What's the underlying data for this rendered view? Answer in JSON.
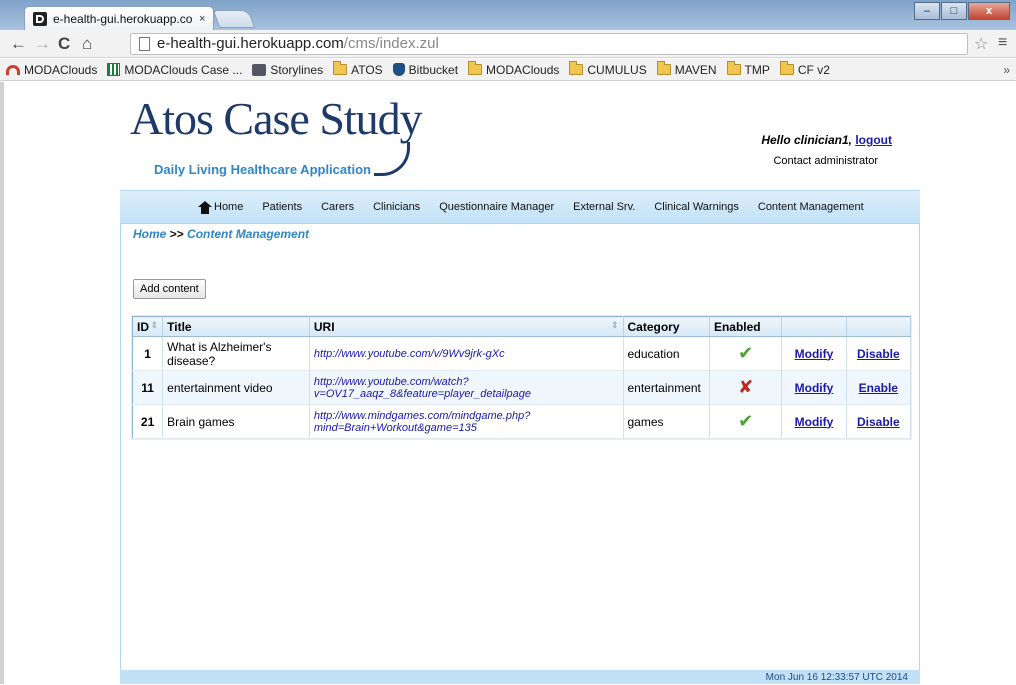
{
  "browser": {
    "tab_title": "e-health-gui.herokuapp.co",
    "tab_close": "×",
    "url_host": "e-health-gui.herokuapp.com",
    "url_path": "/cms/index.zul",
    "window_buttons": [
      "–",
      "□",
      "x"
    ],
    "bookmarks": [
      {
        "label": "MODAClouds",
        "icon": "modaclouds-icon"
      },
      {
        "label": "MODAClouds Case ...",
        "icon": "sheet-icon"
      },
      {
        "label": "Storylines",
        "icon": "storyline-icon"
      },
      {
        "label": "ATOS",
        "icon": "folder-icon"
      },
      {
        "label": "Bitbucket",
        "icon": "bitbucket-icon"
      },
      {
        "label": "MODAClouds",
        "icon": "folder-icon"
      },
      {
        "label": "CUMULUS",
        "icon": "folder-icon"
      },
      {
        "label": "MAVEN",
        "icon": "folder-icon"
      },
      {
        "label": "TMP",
        "icon": "folder-icon"
      },
      {
        "label": "CF v2",
        "icon": "folder-icon"
      }
    ],
    "bookmarks_more": "»"
  },
  "header": {
    "title": "Atos Case Study",
    "subtitle": "Daily Living Healthcare Application",
    "greeting": "Hello clinician1, ",
    "logout": "logout",
    "contact": "Contact administrator"
  },
  "nav": {
    "items": [
      "Home",
      "Patients",
      "Carers",
      "Clinicians",
      "Questionnaire Manager",
      "External Srv.",
      "Clinical Warnings",
      "Content Management"
    ]
  },
  "breadcrumb": {
    "home": "Home",
    "sep": ">>",
    "current": "Content Management"
  },
  "add_button": "Add content",
  "table": {
    "columns": [
      "ID",
      "Title",
      "URI",
      "Category",
      "Enabled",
      "",
      ""
    ],
    "rows": [
      {
        "id": "1",
        "title": "What is Alzheimer's disease?",
        "uri": "http://www.youtube.com/v/9Wv9jrk-gXc",
        "category": "education",
        "enabled": "✔",
        "modify": "Modify",
        "toggle": "Disable"
      },
      {
        "id": "11",
        "title": "entertainment video",
        "uri": "http://www.youtube.com/watch?v=OV17_aaqz_8&feature=player_detailpage",
        "category": "entertainment",
        "enabled": "✘",
        "modify": "Modify",
        "toggle": "Enable"
      },
      {
        "id": "21",
        "title": "Brain games",
        "uri": "http://www.mindgames.com/mindgame.php?mind=Brain+Workout&game=135",
        "category": "games",
        "enabled": "✔",
        "modify": "Modify",
        "toggle": "Disable"
      }
    ]
  },
  "footer": {
    "timestamp": "Mon Jun 16 12:33:57 UTC 2014"
  }
}
